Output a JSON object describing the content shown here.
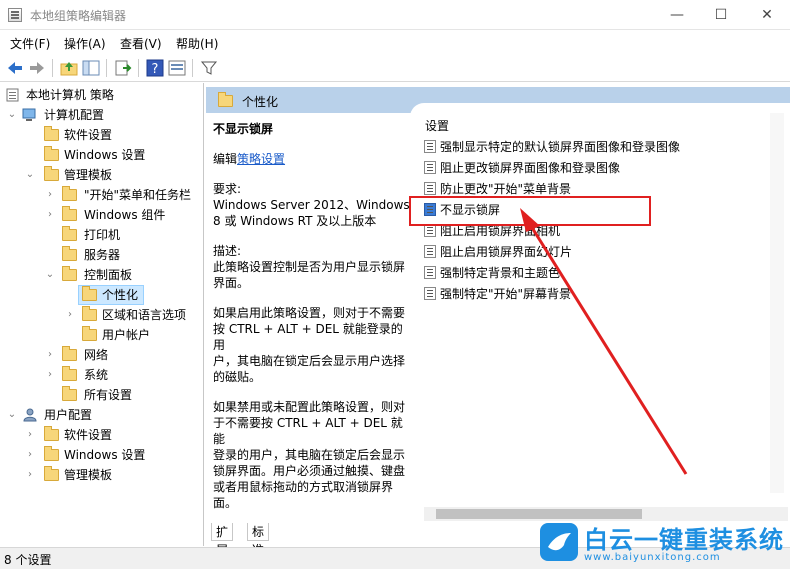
{
  "window": {
    "title": "本地组策略编辑器",
    "min_glyph": "—",
    "max_glyph": "☐",
    "close_glyph": "✕"
  },
  "menu": [
    "文件(F)",
    "操作(A)",
    "查看(V)",
    "帮助(H)"
  ],
  "tree": {
    "root": "本地计算机 策略",
    "computer_config": "计算机配置",
    "software_settings": "软件设置",
    "windows_settings": "Windows 设置",
    "admin_templates": "管理模板",
    "start_menu": "\"开始\"菜单和任务栏",
    "windows_components": "Windows 组件",
    "printers": "打印机",
    "servers": "服务器",
    "control_panel": "控制面板",
    "personalization": "个性化",
    "region_language": "区域和语言选项",
    "user_accounts": "用户帐户",
    "network": "网络",
    "system": "系统",
    "all_settings": "所有设置",
    "user_config": "用户配置",
    "u_software_settings": "软件设置",
    "u_windows_settings": "Windows 设置",
    "u_admin_templates": "管理模板"
  },
  "header": {
    "title": "个性化"
  },
  "description": {
    "policy_title": "不显示锁屏",
    "edit_prefix": "编辑",
    "edit_link": "策略设置",
    "requirements_label": "要求:",
    "requirements_line1": "Windows Server 2012、Windows",
    "requirements_line2": "8 或 Windows RT 及以上版本",
    "desc_label": "描述:",
    "desc_line1": "此策略设置控制是否为用户显示锁屏",
    "desc_line2": "界面。",
    "p1_line1": "如果启用此策略设置，则对于不需要",
    "p1_line2": "按 CTRL + ALT + DEL 就能登录的用",
    "p1_line3": "户，其电脑在锁定后会显示用户选择",
    "p1_line4": "的磁贴。",
    "p2_line1": "如果禁用或未配置此策略设置，则对",
    "p2_line2": "于不需要按 CTRL + ALT + DEL 就能",
    "p2_line3": "登录的用户，其电脑在锁定后会显示",
    "p2_line4": "锁屏界面。用户必须通过触摸、键盘",
    "p2_line5": "或者用鼠标拖动的方式取消锁屏界",
    "p2_line6": "面。"
  },
  "list": {
    "header": "设置",
    "items": [
      "强制显示特定的默认锁屏界面图像和登录图像",
      "阻止更改锁屏界面图像和登录图像",
      "防止更改\"开始\"菜单背景",
      "不显示锁屏",
      "阻止启用锁屏界面相机",
      "阻止启用锁屏界面幻灯片",
      "强制特定背景和主题色",
      "强制特定\"开始\"屏幕背景"
    ],
    "selected_index": 3
  },
  "tabs": [
    "扩展",
    "标准"
  ],
  "status": {
    "text": "8 个设置"
  },
  "watermark": {
    "brand": "白云一键重装系统",
    "url": "www.baiyunxitong.com"
  },
  "colors": {
    "accent_header": "#b9d1ea",
    "selected": "#cce8ff",
    "highlight_red": "#e02020",
    "link": "#1a5bc9",
    "watermark": "#1e8fe1"
  }
}
